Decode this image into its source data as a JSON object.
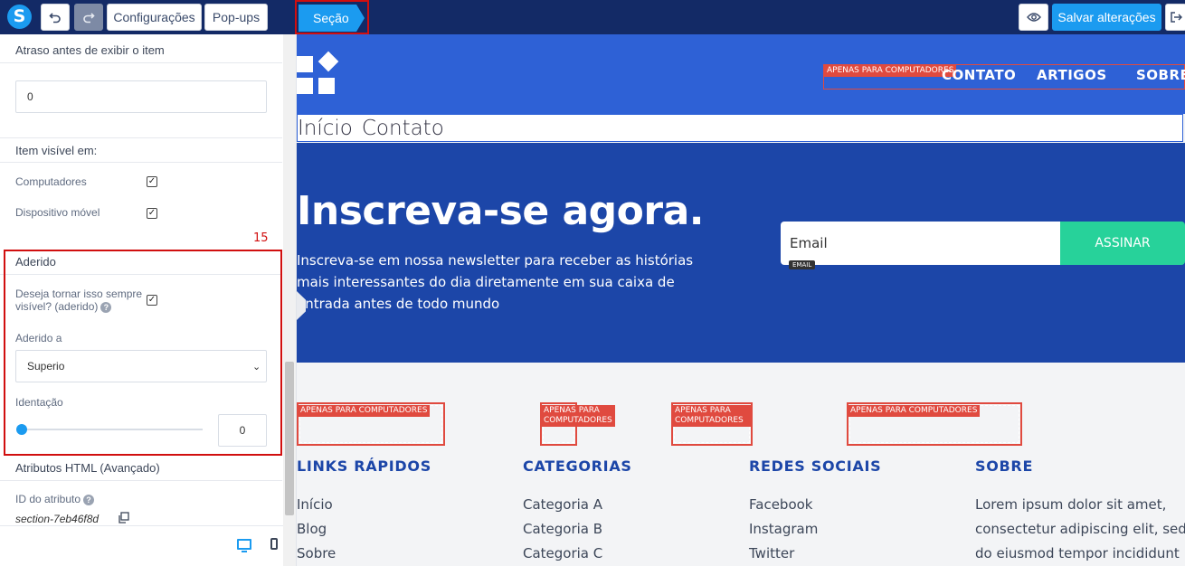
{
  "toolbar": {
    "logo_letter": "S",
    "undo_icon": "undo-icon",
    "redo_icon": "redo-icon",
    "config_label": "Configurações",
    "popups_label": "Pop-ups",
    "section_label": "Seção",
    "preview_icon": "eye-icon",
    "save_label": "Salvar alterações",
    "exit_icon": "exit-icon"
  },
  "panel": {
    "delay": {
      "header": "Atraso antes de exibir o item",
      "value": "0"
    },
    "visibility": {
      "header": "Item visível em:",
      "items": [
        {
          "label": "Computadores",
          "checked": true
        },
        {
          "label": "Dispositivo móvel",
          "checked": true
        }
      ]
    },
    "annotation_number": "15",
    "sticky": {
      "header": "Aderido",
      "question_line1": "Deseja tornar isso sempre",
      "question_line2": "visível? (aderido)",
      "question_checked": true,
      "adhered_label": "Aderido a",
      "adhered_value": "Superio",
      "indent_label": "Identação",
      "indent_value": "0",
      "indent_level": 0
    },
    "html_attrs": {
      "header": "Atributos HTML (Avançado)",
      "id_label": "ID do atributo",
      "id_value": "section-7eb46f8d"
    }
  },
  "site": {
    "nav": {
      "links": [
        "CONTATO",
        "ARTIGOS",
        "SOBRE"
      ],
      "desktop_tag": "APENAS PARA COMPUTADORES"
    },
    "mobile_nav": [
      "Início",
      "Contato"
    ],
    "newsletter": {
      "title": "Inscreva-se agora.",
      "text": "Inscreva-se em nossa newsletter para receber as histórias mais interessantes do dia diretamente em sua caixa de entrada antes de todo mundo",
      "email_placeholder": "Email",
      "email_tag": "EMAIL",
      "button": "ASSINAR"
    },
    "footer": {
      "desktop_tag": "APENAS PARA COMPUTADORES",
      "columns": [
        {
          "title": "LINKS RÁPIDOS",
          "items": [
            "Início",
            "Blog",
            "Sobre"
          ]
        },
        {
          "title": "CATEGORIAS",
          "items": [
            "Categoria A",
            "Categoria B",
            "Categoria C"
          ]
        },
        {
          "title": "REDES SOCIAIS",
          "items": [
            "Facebook",
            "Instagram",
            "Twitter"
          ]
        },
        {
          "title": "SOBRE",
          "items": [
            "Lorem ipsum dolor sit amet,",
            "consectetur adipiscing elit, sed",
            "do eiusmod tempor incididunt"
          ]
        }
      ]
    }
  },
  "colors": {
    "topbar": "#132a66",
    "accent": "#1b9bf0",
    "nav_blue": "#2e61d6",
    "newsletter_blue": "#1c46a8",
    "subscribe_green": "#27d29a",
    "highlight_red": "#d10f0f"
  }
}
